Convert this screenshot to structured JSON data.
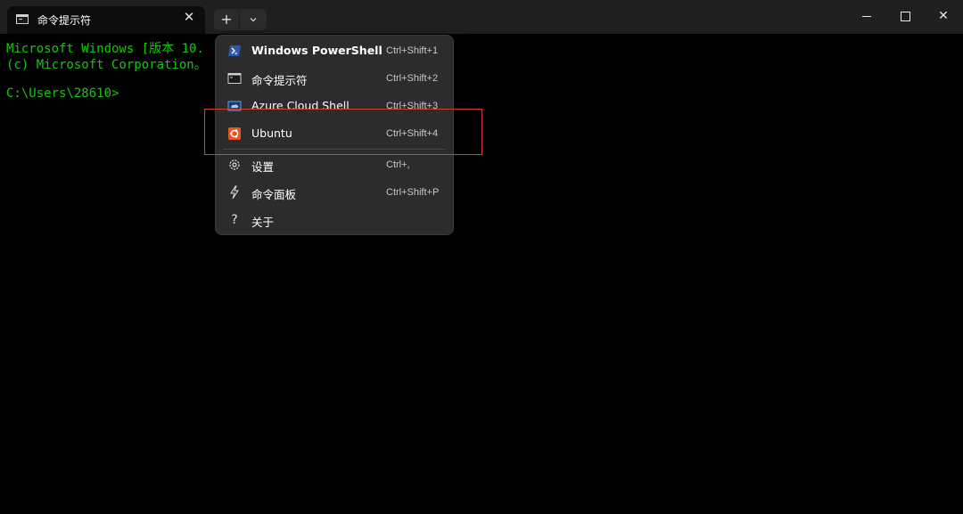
{
  "window": {
    "tab": {
      "title": "命令提示符",
      "close": "✕",
      "icon": "cmd-icon"
    },
    "new_tab": "+",
    "dropdown": "⌄",
    "controls": {
      "minimize": "",
      "maximize": "",
      "close": "✕"
    }
  },
  "terminal": {
    "lines": [
      "Microsoft Windows [版本 10.",
      "(c) Microsoft Corporation。",
      "",
      "C:\\Users\\28610>"
    ],
    "text_color": "#16c60c"
  },
  "menu": {
    "profiles": [
      {
        "label": "Windows PowerShell",
        "shortcut": "Ctrl+Shift+1",
        "icon": "powershell-icon"
      },
      {
        "label": "命令提示符",
        "shortcut": "Ctrl+Shift+2",
        "icon": "cmd-icon"
      },
      {
        "label": "Azure Cloud Shell",
        "shortcut": "Ctrl+Shift+3",
        "icon": "azure-icon"
      },
      {
        "label": "Ubuntu",
        "shortcut": "Ctrl+Shift+4",
        "icon": "ubuntu-icon"
      }
    ],
    "actions": [
      {
        "label": "设置",
        "shortcut": "Ctrl+,",
        "icon": "gear-icon"
      },
      {
        "label": "命令面板",
        "shortcut": "Ctrl+Shift+P",
        "icon": "lightning-icon"
      },
      {
        "label": "关于",
        "shortcut": "",
        "icon": "question-icon"
      }
    ]
  },
  "colors": {
    "highlight_box": "#d0402f",
    "ubuntu": "#e95420",
    "powershell": "#2f5aa8"
  }
}
